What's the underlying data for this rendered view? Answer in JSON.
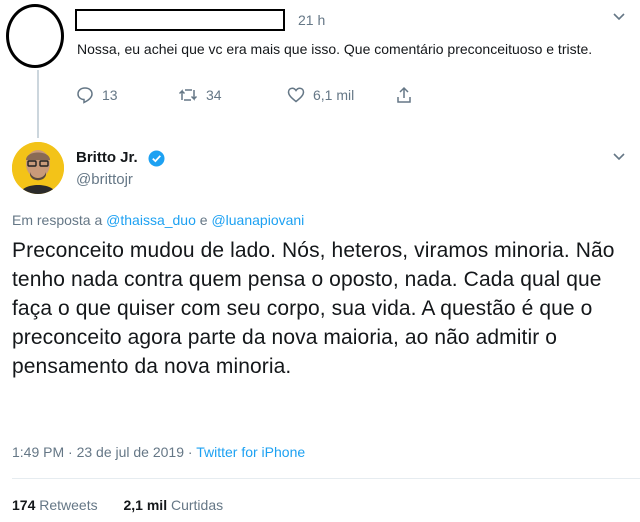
{
  "reply": {
    "time": "21 h",
    "text": "Nossa, eu achei que vc era mais que isso. Que comentário preconceituoso e triste.",
    "replies": "13",
    "retweets": "34",
    "likes": "6,1 mil"
  },
  "tweet": {
    "name": "Britto Jr.",
    "handle": "@brittojr",
    "in_reply_prefix": "Em resposta a",
    "in_reply_user1": "@thaissa_duo",
    "in_reply_and": "e",
    "in_reply_user2": "@luanapiovani",
    "body": "Preconceito mudou de lado. Nós, heteros, viramos minoria. Não tenho nada contra quem pensa o oposto, nada. Cada qual que faça o que quiser com seu corpo, sua vida. A questão é que o preconceito agora parte da nova maioria, ao não admitir o pensamento da nova minoria.",
    "timestamp": "1:49 PM · 23 de jul de 2019 ·",
    "source": "Twitter for iPhone",
    "retweet_count": "174",
    "retweet_label": "Retweets",
    "like_count": "2,1 mil",
    "like_label": "Curtidas"
  },
  "colors": {
    "link": "#1da1f2",
    "muted": "#657786",
    "verified": "#1da1f2"
  }
}
